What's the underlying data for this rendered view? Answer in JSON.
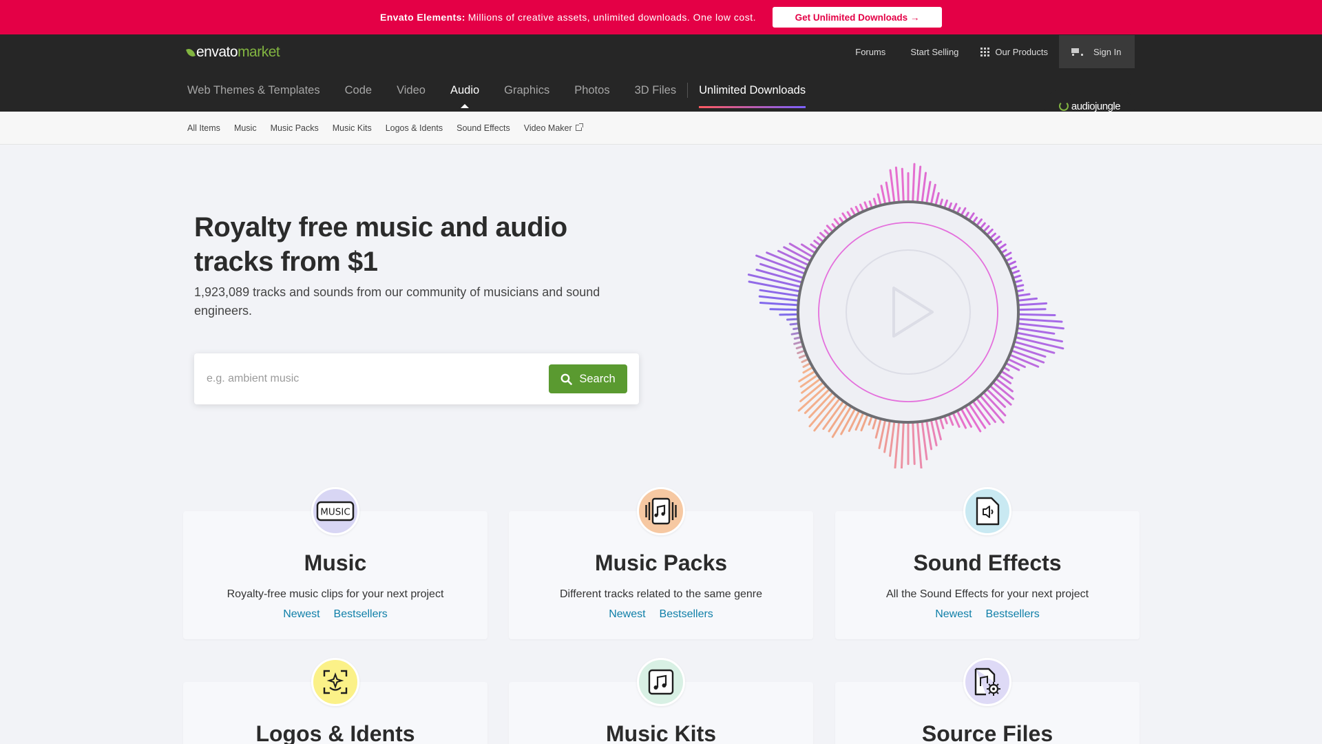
{
  "promo": {
    "lead": "Envato Elements:",
    "message": "Millions of creative assets, unlimited downloads. One low cost.",
    "button": "Get Unlimited Downloads →"
  },
  "header": {
    "logo_envato": "envato",
    "logo_market": "market",
    "util": {
      "forums": "Forums",
      "start_selling": "Start Selling",
      "our_products": "Our Products",
      "sign_in": "Sign In"
    },
    "categories": [
      {
        "label": "Web Themes & Templates"
      },
      {
        "label": "Code"
      },
      {
        "label": "Video"
      },
      {
        "label": "Audio"
      },
      {
        "label": "Graphics"
      },
      {
        "label": "Photos"
      },
      {
        "label": "3D Files"
      }
    ],
    "unlimited": "Unlimited Downloads",
    "badge": "audiojungle"
  },
  "subnav": {
    "items": [
      "All Items",
      "Music",
      "Music Packs",
      "Music Kits",
      "Logos & Idents",
      "Sound Effects",
      "Video Maker"
    ]
  },
  "hero": {
    "title": "Royalty free music and audio tracks from $1",
    "subtitle": "1,923,089 tracks and sounds from our community of musicians and sound engineers.",
    "search_placeholder": "e.g. ambient music",
    "search_value": "",
    "search_button": "Search"
  },
  "cards": [
    {
      "title": "Music",
      "desc": "Royalty-free music clips for your next project",
      "newest": "Newest",
      "bestsellers": "Bestsellers",
      "icon": "music-label-icon",
      "icon_bg": "#d8d6f4",
      "icon_text": "MUSIC"
    },
    {
      "title": "Music Packs",
      "desc": "Different tracks related to the same genre",
      "newest": "Newest",
      "bestsellers": "Bestsellers",
      "icon": "music-pack-icon",
      "icon_bg": "#f6c8a2"
    },
    {
      "title": "Sound Effects",
      "desc": "All the Sound Effects for your next project",
      "newest": "Newest",
      "bestsellers": "Bestsellers",
      "icon": "sound-file-icon",
      "icon_bg": "#c9e9f2"
    },
    {
      "title": "Logos & Idents",
      "icon": "sparkle-icon",
      "icon_bg": "#fbf188"
    },
    {
      "title": "Music Kits",
      "icon": "music-note-icon",
      "icon_bg": "#d8f0e4"
    },
    {
      "title": "Source Files",
      "icon": "file-gear-icon",
      "icon_bg": "#dedaf6"
    }
  ],
  "colors": {
    "promo_bg": "#e40046",
    "nav_bg": "#262626",
    "accent_green": "#82b541",
    "search_green": "#5a9a30",
    "link_blue": "#0f7fa8"
  }
}
